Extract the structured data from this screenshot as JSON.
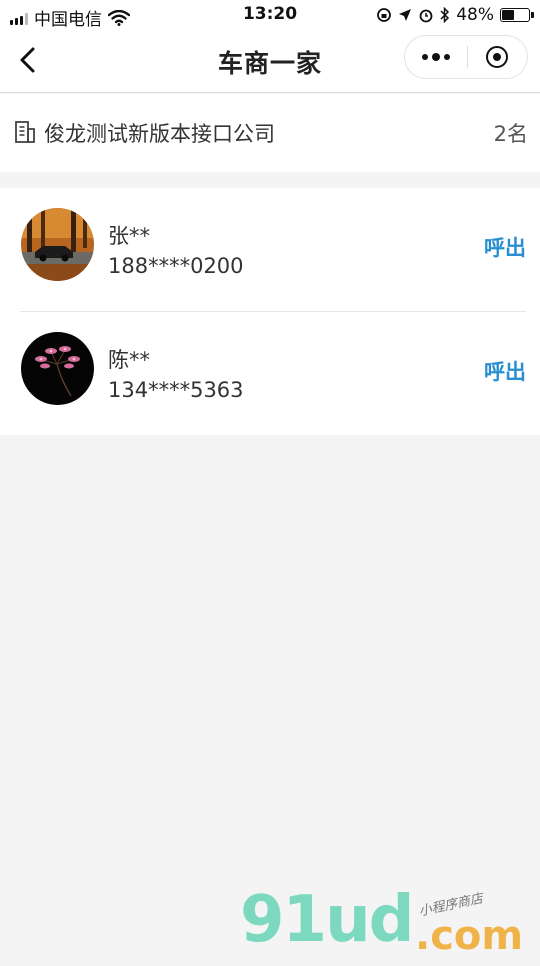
{
  "status_bar": {
    "carrier": "中国电信",
    "time": "13:20",
    "battery": "48%",
    "battery_level": 0.48
  },
  "navbar": {
    "title": "车商一家"
  },
  "company": {
    "name": "俊龙测试新版本接口公司",
    "count": "2名"
  },
  "contacts": [
    {
      "name": "张**",
      "phone": "188****0200",
      "action": "呼出"
    },
    {
      "name": "陈**",
      "phone": "134****5363",
      "action": "呼出"
    }
  ],
  "watermark": {
    "brand": "91ud",
    "suffix": ".com",
    "tagline": "小程序商店"
  },
  "colors": {
    "accent": "#2a8fd0",
    "background": "#f4f4f4"
  }
}
